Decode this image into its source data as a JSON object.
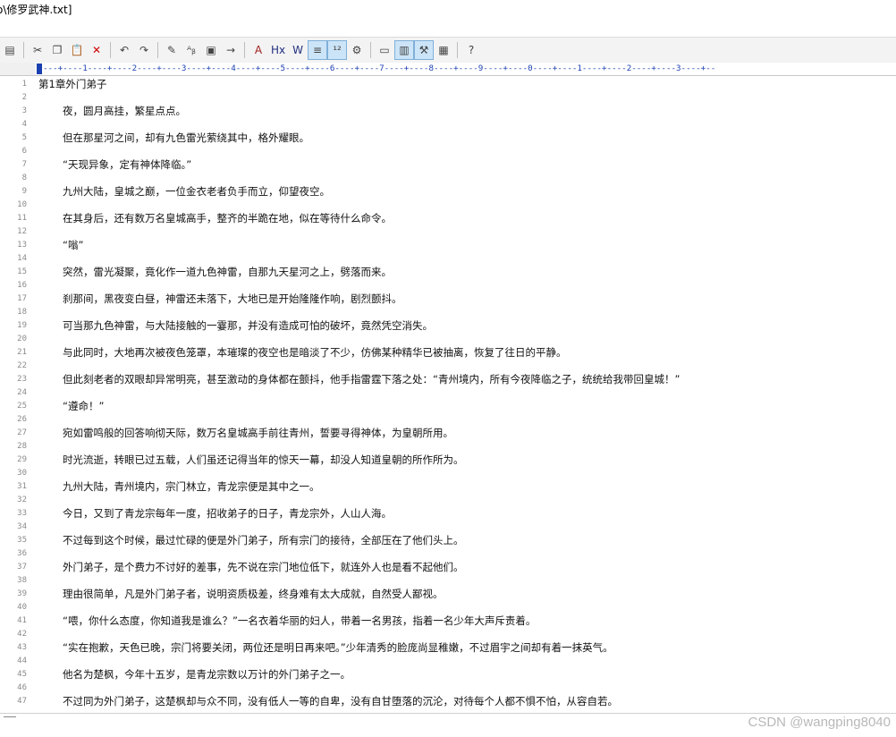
{
  "window": {
    "title": "o\\修罗武神.txt]"
  },
  "toolbar": {
    "buttons": [
      {
        "name": "document-icon",
        "glyph": "▤"
      },
      {
        "sep": true
      },
      {
        "name": "cut-icon",
        "glyph": "✂"
      },
      {
        "name": "copy-icon",
        "glyph": "❐"
      },
      {
        "name": "paste-icon",
        "glyph": "📋"
      },
      {
        "name": "delete-icon",
        "glyph": "✕",
        "color": "#d00000"
      },
      {
        "sep": true
      },
      {
        "name": "undo-icon",
        "glyph": "↶"
      },
      {
        "name": "redo-icon",
        "glyph": "↷"
      },
      {
        "sep": true
      },
      {
        "name": "find-icon",
        "glyph": "✎"
      },
      {
        "name": "replace-icon",
        "glyph": "ᴬᵦ"
      },
      {
        "name": "find-in-files-icon",
        "glyph": "▣"
      },
      {
        "name": "goto-icon",
        "glyph": "→"
      },
      {
        "sep": true
      },
      {
        "name": "font-icon",
        "glyph": "A",
        "color": "#a02020"
      },
      {
        "name": "header-icon",
        "glyph": "Hx",
        "color": "#203080"
      },
      {
        "name": "italic-w-icon",
        "glyph": "W",
        "color": "#203080"
      },
      {
        "name": "word-wrap-icon",
        "glyph": "≡",
        "active": true
      },
      {
        "name": "line-numbers-icon",
        "glyph": "¹²",
        "active": true
      },
      {
        "name": "settings-icon",
        "glyph": "⚙"
      },
      {
        "sep": true
      },
      {
        "name": "view-single-icon",
        "glyph": "▭"
      },
      {
        "name": "view-split-icon",
        "glyph": "▥",
        "active": true
      },
      {
        "name": "tool-icon",
        "glyph": "⚒",
        "active": true
      },
      {
        "name": "print-icon",
        "glyph": "▦"
      },
      {
        "sep": true
      },
      {
        "name": "help-icon",
        "glyph": "?"
      }
    ]
  },
  "ruler": {
    "text": "---+----1----+----2----+----3----+----4----+----5----+----6----+----7----+----8----+----9----+----0----+----1----+----2----+----3----+--"
  },
  "lines": [
    {
      "n": "1",
      "t": "第1章外门弟子",
      "indent": false
    },
    {
      "n": "2",
      "t": ""
    },
    {
      "n": "3",
      "t": "夜，圆月高挂，繁星点点。",
      "indent": true
    },
    {
      "n": "4",
      "t": ""
    },
    {
      "n": "5",
      "t": "但在那星河之间，却有九色雷光萦绕其中，格外耀眼。",
      "indent": true
    },
    {
      "n": "6",
      "t": ""
    },
    {
      "n": "7",
      "t": "“天现异象，定有神体降临。”",
      "indent": true
    },
    {
      "n": "8",
      "t": ""
    },
    {
      "n": "9",
      "t": "九州大陆，皇城之巅，一位金衣老者负手而立，仰望夜空。",
      "indent": true
    },
    {
      "n": "10",
      "t": ""
    },
    {
      "n": "11",
      "t": "在其身后，还有数万名皇城高手，整齐的半跪在地，似在等待什么命令。",
      "indent": true
    },
    {
      "n": "12",
      "t": ""
    },
    {
      "n": "13",
      "t": "“嗡”",
      "indent": true
    },
    {
      "n": "14",
      "t": ""
    },
    {
      "n": "15",
      "t": "突然，雷光凝聚，竟化作一道九色神雷，自那九天星河之上，劈落而来。",
      "indent": true
    },
    {
      "n": "16",
      "t": ""
    },
    {
      "n": "17",
      "t": "刹那间，黑夜变白昼，神雷还未落下，大地已是开始隆隆作响，剧烈颤抖。",
      "indent": true
    },
    {
      "n": "18",
      "t": ""
    },
    {
      "n": "19",
      "t": "可当那九色神雷，与大陆接触的一霎那，并没有造成可怕的破坏，竟然凭空消失。",
      "indent": true
    },
    {
      "n": "20",
      "t": ""
    },
    {
      "n": "21",
      "t": "与此同时，大地再次被夜色笼罩，本璀璨的夜空也是暗淡了不少，仿佛某种精华已被抽离，恢复了往日的平静。",
      "indent": true
    },
    {
      "n": "22",
      "t": ""
    },
    {
      "n": "23",
      "t": "但此刻老者的双眼却异常明亮，甚至激动的身体都在颤抖，他手指雷霆下落之处：“青州境内，所有今夜降临之子，统统给我带回皇城！”",
      "indent": true
    },
    {
      "n": "24",
      "t": ""
    },
    {
      "n": "25",
      "t": "“遵命！”",
      "indent": true
    },
    {
      "n": "26",
      "t": ""
    },
    {
      "n": "27",
      "t": "宛如雷鸣般的回答响彻天际，数万名皇城高手前往青州，誓要寻得神体，为皇朝所用。",
      "indent": true
    },
    {
      "n": "28",
      "t": ""
    },
    {
      "n": "29",
      "t": "时光流逝，转眼已过五载，人们虽还记得当年的惊天一幕，却没人知道皇朝的所作所为。",
      "indent": true
    },
    {
      "n": "30",
      "t": ""
    },
    {
      "n": "31",
      "t": "九州大陆，青州境内，宗门林立，青龙宗便是其中之一。",
      "indent": true
    },
    {
      "n": "32",
      "t": ""
    },
    {
      "n": "33",
      "t": "今日，又到了青龙宗每年一度，招收弟子的日子，青龙宗外，人山人海。",
      "indent": true
    },
    {
      "n": "34",
      "t": ""
    },
    {
      "n": "35",
      "t": "不过每到这个时候，最过忙碌的便是外门弟子，所有宗门的接待，全部压在了他们头上。",
      "indent": true
    },
    {
      "n": "36",
      "t": ""
    },
    {
      "n": "37",
      "t": "外门弟子，是个费力不讨好的差事，先不说在宗门地位低下，就连外人也是看不起他们。",
      "indent": true
    },
    {
      "n": "38",
      "t": ""
    },
    {
      "n": "39",
      "t": "理由很简单，凡是外门弟子者，说明资质极差，终身难有太大成就，自然受人鄙视。",
      "indent": true
    },
    {
      "n": "40",
      "t": ""
    },
    {
      "n": "41",
      "t": "“喂，你什么态度，你知道我是谁么？”一名衣着华丽的妇人，带着一名男孩，指着一名少年大声斥责着。",
      "indent": true
    },
    {
      "n": "42",
      "t": ""
    },
    {
      "n": "43",
      "t": "“实在抱歉，天色已晚，宗门将要关闭，两位还是明日再来吧。”少年清秀的脸庞尚显稚嫩，不过眉宇之间却有着一抹英气。",
      "indent": true
    },
    {
      "n": "44",
      "t": ""
    },
    {
      "n": "45",
      "t": "他名为楚枫，今年十五岁，是青龙宗数以万计的外门弟子之一。",
      "indent": true
    },
    {
      "n": "46",
      "t": ""
    },
    {
      "n": "47",
      "t": "不过同为外门弟子，这楚枫却与众不同，没有低人一等的自卑，没有自甘堕落的沉沦，对待每个人都不惧不怕，从容自若。",
      "indent": true
    }
  ],
  "watermark": "CSDN @wangping8040"
}
